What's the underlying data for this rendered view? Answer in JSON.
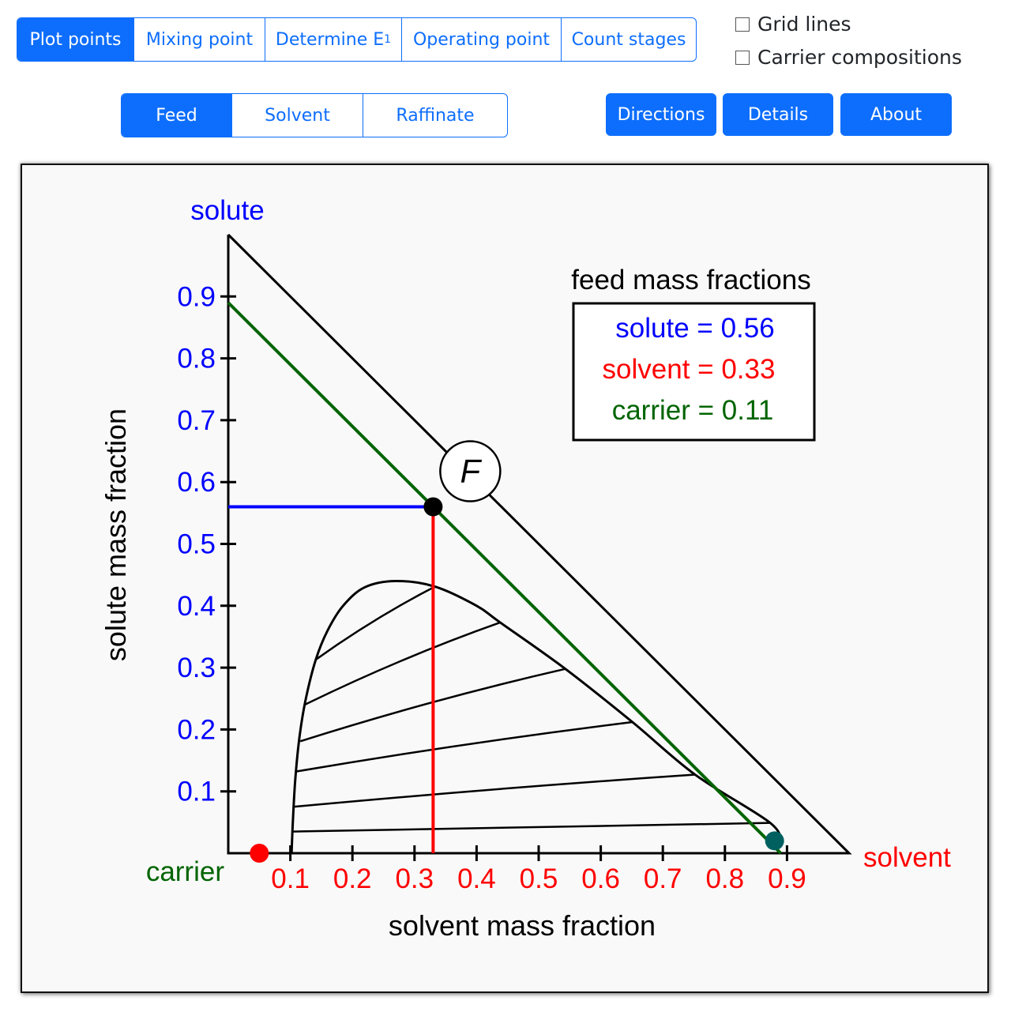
{
  "toolbar": {
    "tabs": [
      {
        "label": "Plot points",
        "active": true
      },
      {
        "label": "Mixing point",
        "active": false
      },
      {
        "label": "Determine E",
        "subscript": "1",
        "active": false
      },
      {
        "label": "Operating point",
        "active": false
      },
      {
        "label": "Count stages",
        "active": false
      }
    ],
    "checkboxes": [
      {
        "label": "Grid lines",
        "checked": false
      },
      {
        "label": "Carrier compositions",
        "checked": false
      }
    ],
    "stream_tabs": [
      {
        "label": "Feed",
        "active": true
      },
      {
        "label": "Solvent",
        "active": false
      },
      {
        "label": "Raffinate",
        "active": false
      }
    ],
    "buttons": {
      "directions": "Directions",
      "details": "Details",
      "about": "About"
    }
  },
  "colors": {
    "accent": "#0d6efd",
    "solute": "#0000ff",
    "solvent": "#ff0000",
    "carrier": "#006400",
    "solvent_point": "#ff0000",
    "extract_point": "#006060"
  },
  "chart_data": {
    "type": "scatter",
    "subtype": "ternary-right-triangle",
    "title": "",
    "xlabel": "solvent mass fraction",
    "ylabel": "solute mass fraction",
    "vertex_labels": {
      "top": "solute",
      "bottom_left": "carrier",
      "bottom_right": "solvent"
    },
    "xlim": [
      0,
      1
    ],
    "ylim": [
      0,
      1
    ],
    "x_ticks": [
      0.1,
      0.2,
      0.3,
      0.4,
      0.5,
      0.6,
      0.7,
      0.8,
      0.9
    ],
    "x_tick_labels": [
      "0.1",
      "0.2",
      "0.3",
      "0.4",
      "0.5",
      "0.6",
      "0.7",
      "0.8",
      "0.9"
    ],
    "y_ticks": [
      0.1,
      0.2,
      0.3,
      0.4,
      0.5,
      0.6,
      0.7,
      0.8,
      0.9
    ],
    "y_tick_labels": [
      "0.1",
      "0.2",
      "0.3",
      "0.4",
      "0.5",
      "0.6",
      "0.7",
      "0.8",
      "0.9"
    ],
    "grid": false,
    "binodal_curve": [
      [
        0.102,
        0.0
      ],
      [
        0.104,
        0.05
      ],
      [
        0.108,
        0.12
      ],
      [
        0.115,
        0.19
      ],
      [
        0.125,
        0.25
      ],
      [
        0.141,
        0.313
      ],
      [
        0.16,
        0.36
      ],
      [
        0.185,
        0.4
      ],
      [
        0.22,
        0.43
      ],
      [
        0.27,
        0.44
      ],
      [
        0.333,
        0.431
      ],
      [
        0.4,
        0.4
      ],
      [
        0.438,
        0.373
      ],
      [
        0.543,
        0.298
      ],
      [
        0.651,
        0.212
      ],
      [
        0.752,
        0.127
      ],
      [
        0.873,
        0.049
      ],
      [
        0.89,
        0.015
      ]
    ],
    "tie_lines": [
      {
        "raffinate": [
          0.103,
          0.035
        ],
        "extract": [
          0.873,
          0.049
        ]
      },
      {
        "raffinate": [
          0.105,
          0.075
        ],
        "extract": [
          0.752,
          0.127
        ]
      },
      {
        "raffinate": [
          0.109,
          0.132
        ],
        "extract": [
          0.651,
          0.212
        ]
      },
      {
        "raffinate": [
          0.116,
          0.181
        ],
        "extract": [
          0.543,
          0.298
        ]
      },
      {
        "raffinate": [
          0.123,
          0.24
        ],
        "extract": [
          0.438,
          0.373
        ]
      },
      {
        "raffinate": [
          0.141,
          0.313
        ],
        "extract": [
          0.333,
          0.431
        ]
      }
    ],
    "feed_point": {
      "label": "F",
      "x": 0.33,
      "y": 0.56
    },
    "carrier_line": {
      "carrier_fraction": 0.11,
      "from": [
        0.0,
        0.89
      ],
      "to": [
        0.89,
        0.0
      ]
    },
    "solute_guide": {
      "from": [
        0.0,
        0.56
      ],
      "to": [
        0.33,
        0.56
      ]
    },
    "solvent_guide": {
      "from": [
        0.33,
        0.0
      ],
      "to": [
        0.33,
        0.56
      ]
    },
    "extra_points": [
      {
        "name": "red-point",
        "x": 0.05,
        "y": 0.0
      },
      {
        "name": "teal-point",
        "x": 0.88,
        "y": 0.02
      }
    ],
    "info_box": {
      "title": "feed mass fractions",
      "lines": [
        {
          "text": "solute = 0.56",
          "color": "solute"
        },
        {
          "text": "solvent = 0.33",
          "color": "solvent"
        },
        {
          "text": "carrier = 0.11",
          "color": "carrier"
        }
      ]
    }
  }
}
